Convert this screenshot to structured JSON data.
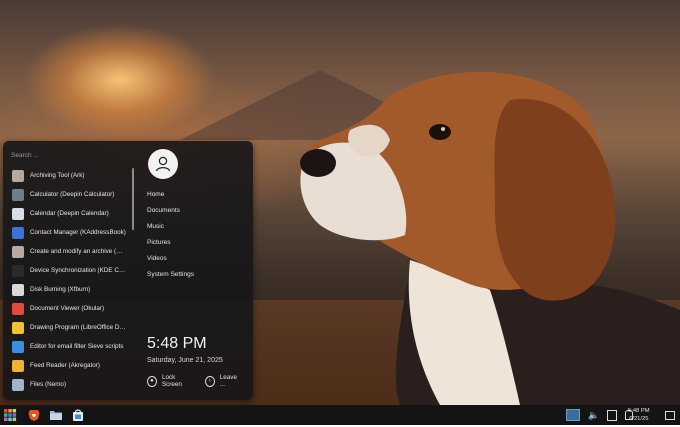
{
  "start_menu": {
    "search_placeholder": "Search ...",
    "apps": [
      {
        "label": "Archiving Tool (Ark)",
        "icon": "archive-icon",
        "color": "#b8a9a0"
      },
      {
        "label": "Calculator (Deepin Calculator)",
        "icon": "calculator-icon",
        "color": "#6f7d8c"
      },
      {
        "label": "Calendar (Deepin Calendar)",
        "icon": "calendar-icon",
        "color": "#d7dde6"
      },
      {
        "label": "Contact Manager (KAddressBook)",
        "icon": "contacts-icon",
        "color": "#3f6fd8"
      },
      {
        "label": "Create and modify an archive (Ark)",
        "icon": "archive-create-icon",
        "color": "#b8a9a0"
      },
      {
        "label": "Device Synchronization (KDE Connect)",
        "icon": "phone-sync-icon",
        "color": "#2b2b2b"
      },
      {
        "label": "Disk Burning (Xfburn)",
        "icon": "disc-icon",
        "color": "#d9d9d9"
      },
      {
        "label": "Document Viewer (Okular)",
        "icon": "document-viewer-icon",
        "color": "#e24b3b"
      },
      {
        "label": "Drawing Program (LibreOffice Draw)",
        "icon": "drawing-icon",
        "color": "#f2c230"
      },
      {
        "label": "Editor for email filter Sieve scripts",
        "icon": "email-filter-icon",
        "color": "#3b8fe0"
      },
      {
        "label": "Feed Reader (Akregator)",
        "icon": "feed-icon",
        "color": "#f0b030"
      },
      {
        "label": "Files (Nemo)",
        "icon": "folder-icon",
        "color": "#9fb5cc"
      }
    ],
    "places": [
      "Home",
      "Documents",
      "Music",
      "Pictures",
      "Videos",
      "System Settings"
    ],
    "time": "5:48 PM",
    "date": "Saturday, June 21, 2025",
    "lock_label": "Lock Screen",
    "leave_label": "Leave ..."
  },
  "taskbar": {
    "launchers": [
      {
        "name": "app-launcher-icon"
      },
      {
        "name": "brave-browser-icon",
        "color": "#e8531f"
      },
      {
        "name": "file-manager-icon",
        "color": "#9fb8d6"
      },
      {
        "name": "software-store-icon",
        "color": "#3a8ee6"
      }
    ],
    "clock_time": "5:48 PM",
    "clock_date": "6/21/25"
  }
}
